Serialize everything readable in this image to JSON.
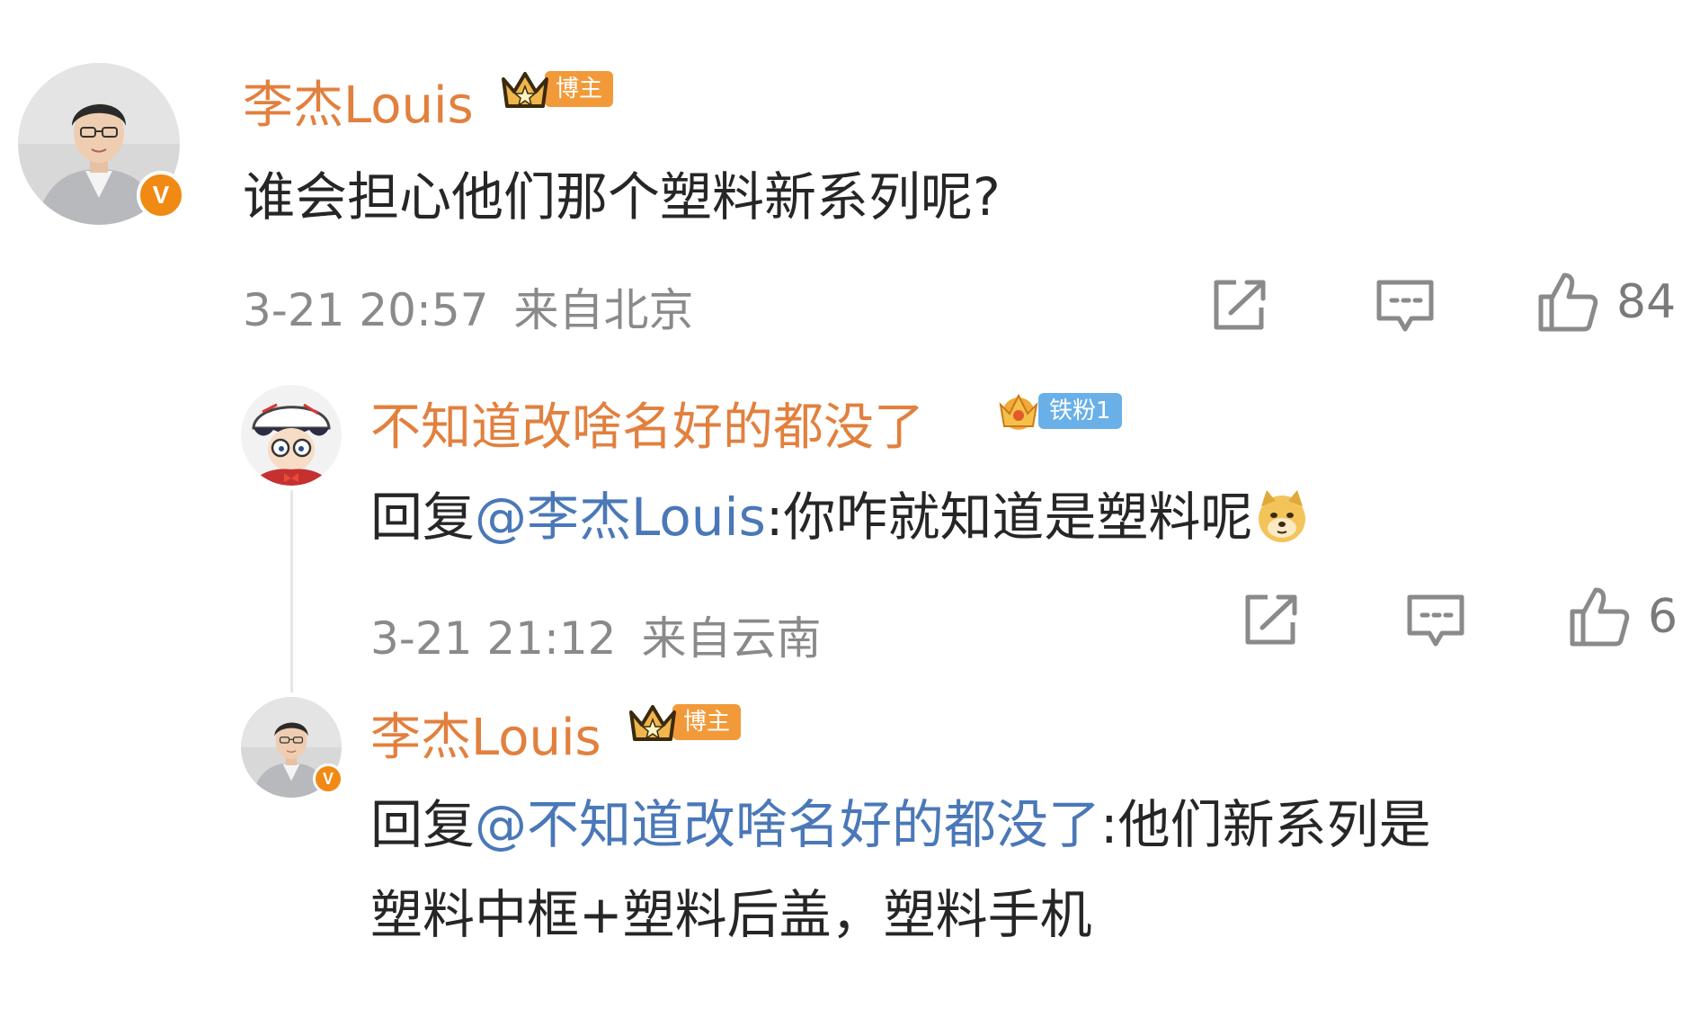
{
  "comment": {
    "author": "李杰Louis",
    "badge_label": "博主",
    "text": "谁会担心他们那个塑料新系列呢?",
    "time": "3-21 20:57",
    "location": "来自北京",
    "likes": "84"
  },
  "reply1": {
    "author": "不知道改啥名好的都没了",
    "badge_label": "铁粉1",
    "reply_prefix": "回复",
    "mention": "@李杰Louis",
    "text": ":你咋就知道是塑料呢",
    "emoji": "doge-emoji",
    "time": "3-21 21:12",
    "location": "来自云南",
    "likes": "6"
  },
  "reply2": {
    "author": "李杰Louis",
    "badge_label": "博主",
    "reply_prefix": "回复",
    "mention": "@不知道改啥名好的都没了",
    "text_line1": ":他们新系列是",
    "text_line2": "塑料中框+塑料后盖，塑料手机"
  },
  "icons": {
    "share": "share-icon",
    "comment": "comment-icon",
    "like": "thumbs-up-icon",
    "crown": "crown-icon",
    "verified": "verified-v-icon"
  },
  "colors": {
    "username": "#e2803e",
    "mention": "#4a78b8",
    "meta": "#8a8a8a",
    "host_tag": "#f29a3a",
    "fan_tag": "#6ab0e8",
    "verified": "#f08a14"
  }
}
